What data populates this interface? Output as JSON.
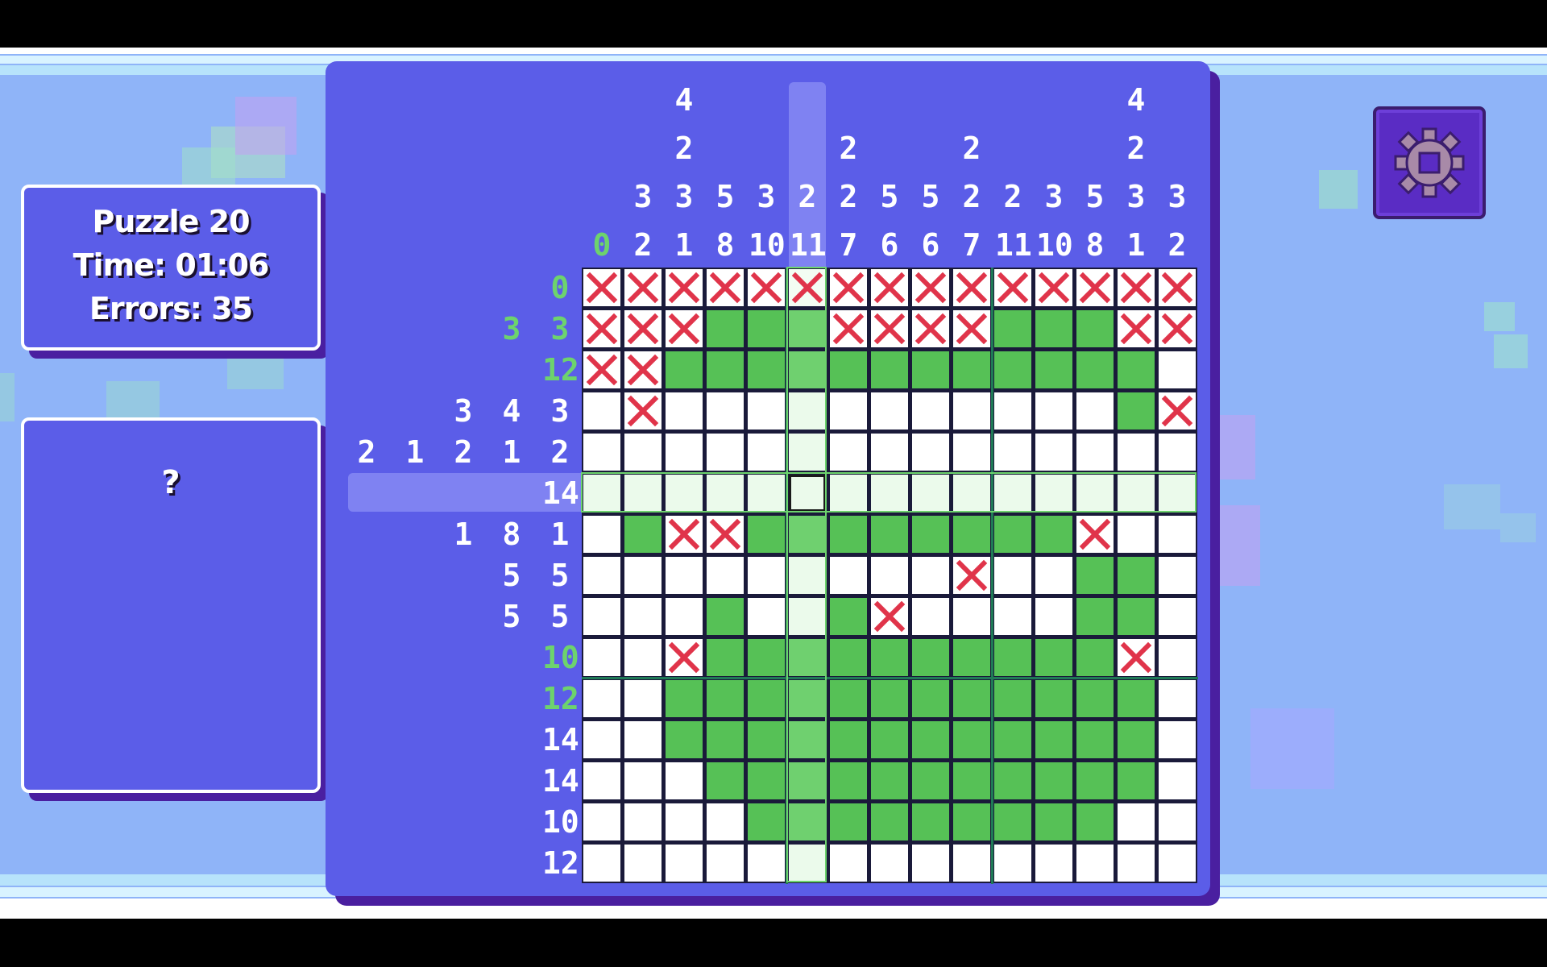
{
  "info": {
    "puzzle": "Puzzle 20",
    "time": "Time: 01:06",
    "errors": "Errors: 35"
  },
  "hint": {
    "text": "?"
  },
  "settings": {
    "icon": "gear-icon"
  },
  "colors": {
    "background": "#8fb4f8",
    "panel": "#5b5de8",
    "filled": "#56c156",
    "cross": "#e0344a",
    "clue_done": "#6dd36d",
    "gear_button": "#5a2cc4"
  },
  "column_clues": [
    [
      {
        "v": "0",
        "done": true
      }
    ],
    [
      {
        "v": "3"
      },
      {
        "v": "2"
      }
    ],
    [
      {
        "v": "4"
      },
      {
        "v": "2"
      },
      {
        "v": "3"
      },
      {
        "v": "1"
      }
    ],
    [
      {
        "v": "5"
      },
      {
        "v": "8"
      }
    ],
    [
      {
        "v": "3"
      },
      {
        "v": "10"
      }
    ],
    [
      {
        "v": "2"
      },
      {
        "v": "11"
      }
    ],
    [
      {
        "v": "2"
      },
      {
        "v": "2"
      },
      {
        "v": "7"
      }
    ],
    [
      {
        "v": "5"
      },
      {
        "v": "6"
      }
    ],
    [
      {
        "v": "5"
      },
      {
        "v": "6"
      }
    ],
    [
      {
        "v": "2"
      },
      {
        "v": "2"
      },
      {
        "v": "7"
      }
    ],
    [
      {
        "v": "2"
      },
      {
        "v": "11"
      }
    ],
    [
      {
        "v": "3"
      },
      {
        "v": "10"
      }
    ],
    [
      {
        "v": "5"
      },
      {
        "v": "8"
      }
    ],
    [
      {
        "v": "4"
      },
      {
        "v": "2"
      },
      {
        "v": "3"
      },
      {
        "v": "1"
      }
    ],
    [
      {
        "v": "3"
      },
      {
        "v": "2"
      }
    ]
  ],
  "row_clues": [
    [
      {
        "v": "0",
        "done": true
      }
    ],
    [
      {
        "v": "3",
        "done": true
      },
      {
        "v": "3",
        "done": true
      }
    ],
    [
      {
        "v": "12",
        "done": true
      }
    ],
    [
      {
        "v": "3"
      },
      {
        "v": "4"
      },
      {
        "v": "3"
      }
    ],
    [
      {
        "v": "2"
      },
      {
        "v": "1"
      },
      {
        "v": "2"
      },
      {
        "v": "1"
      },
      {
        "v": "2"
      }
    ],
    [
      {
        "v": "14"
      }
    ],
    [
      {
        "v": "1"
      },
      {
        "v": "8"
      },
      {
        "v": "1"
      }
    ],
    [
      {
        "v": "5"
      },
      {
        "v": "5"
      }
    ],
    [
      {
        "v": "5"
      },
      {
        "v": "5"
      }
    ],
    [
      {
        "v": "10",
        "done": true
      }
    ],
    [
      {
        "v": "12",
        "done": true
      }
    ],
    [
      {
        "v": "14"
      }
    ],
    [
      {
        "v": "14"
      }
    ],
    [
      {
        "v": "10"
      }
    ],
    [
      {
        "v": "12"
      }
    ]
  ],
  "grid": [
    "XXXXXXXXXXXXXXX",
    "XXXFFFXXXXFFFXX",
    "XXFFFFFFFFFFFF.",
    ".X...........FX",
    "...............",
    "...............",
    ".FXXFFFFFFFFX..",
    ".........X..FF.",
    "...F..FX....FF.",
    "..XFFFFFFFFFFX.",
    "..FFFFFFFFFFFF.",
    "..FFFFFFFFFFFF.",
    "...FFFFFFFFFFF.",
    "....FFFFFFFFF..",
    "..............."
  ],
  "highlight": {
    "row": 5,
    "col": 5
  }
}
